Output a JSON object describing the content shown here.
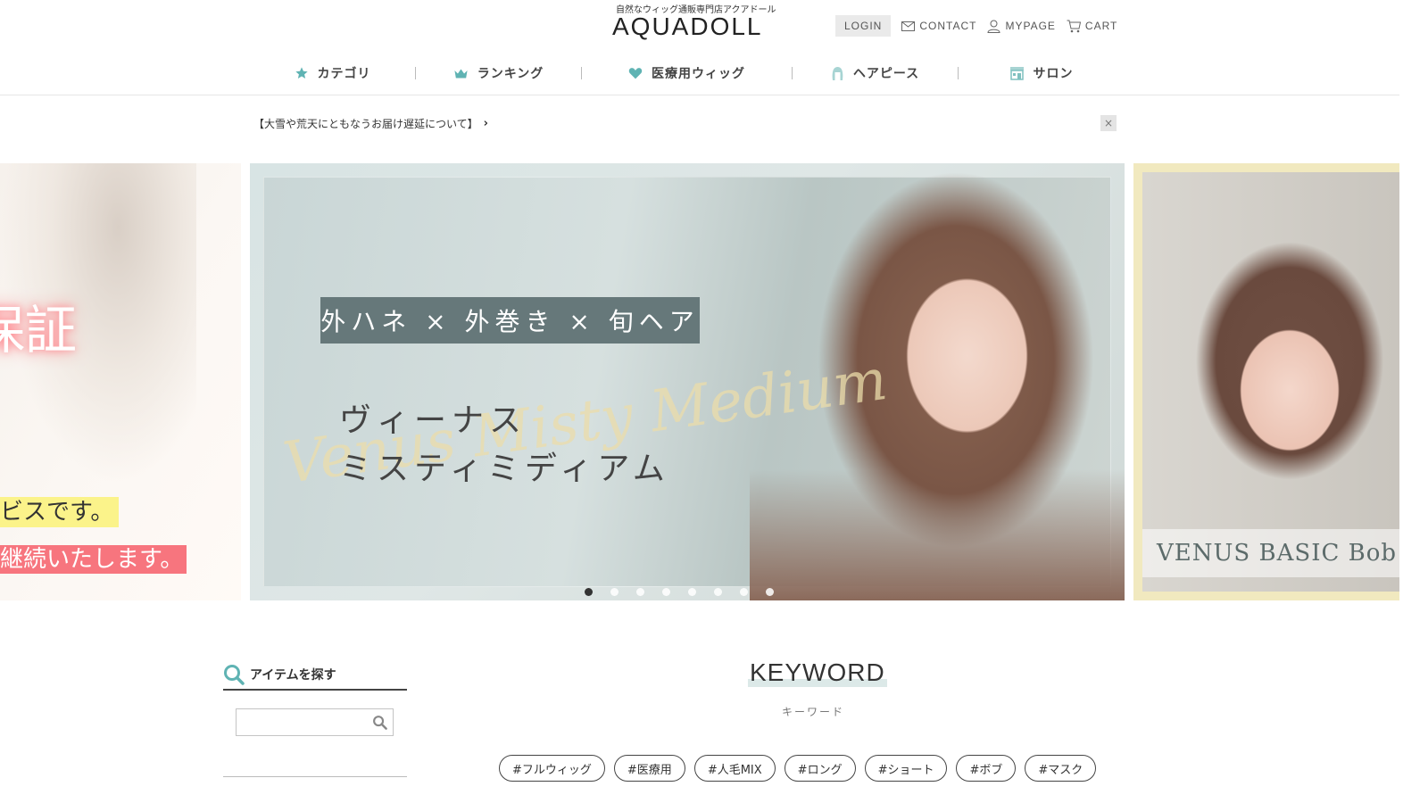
{
  "header": {
    "tagline": "自然なウィッグ通販専門店アクアドール",
    "logo": "AQUADOLL",
    "login": "LOGIN",
    "contact": "CONTACT",
    "mypage": "MYPAGE",
    "cart": "CART"
  },
  "nav": {
    "items": [
      {
        "label": "カテゴリ",
        "icon": "star-icon"
      },
      {
        "label": "ランキング",
        "icon": "crown-icon"
      },
      {
        "label": "医療用ウィッグ",
        "icon": "heart-icon"
      },
      {
        "label": "ヘアピース",
        "icon": "hairpiece-icon"
      },
      {
        "label": "サロン",
        "icon": "shop-icon"
      }
    ],
    "icon_color": "#5fb3b3"
  },
  "notice": {
    "text": "【大雪や荒天にともなうお届け遅延について】",
    "chevron": "›",
    "close": "×"
  },
  "slider": {
    "left": {
      "big_text": "保証",
      "line1": "ビスです。",
      "line2": "継続いたします。"
    },
    "main": {
      "tag": "外ハネ × 外巻き × 旬ヘア",
      "script": "Venus Misty Medium",
      "title_line1": "ヴィーナス",
      "title_line2": "ミスティミディアム",
      "dot_count": 8,
      "active_dot": 0
    },
    "right": {
      "caption": "VENUS BASIC Bob"
    }
  },
  "search": {
    "title": "アイテムを探す",
    "placeholder": "",
    "value": ""
  },
  "keyword": {
    "title": "KEYWORD",
    "subtitle": "キーワード",
    "tags": [
      "#フルウィッグ",
      "#医療用",
      "#人毛MIX",
      "#ロング",
      "#ショート",
      "#ボブ",
      "#マスク"
    ]
  }
}
